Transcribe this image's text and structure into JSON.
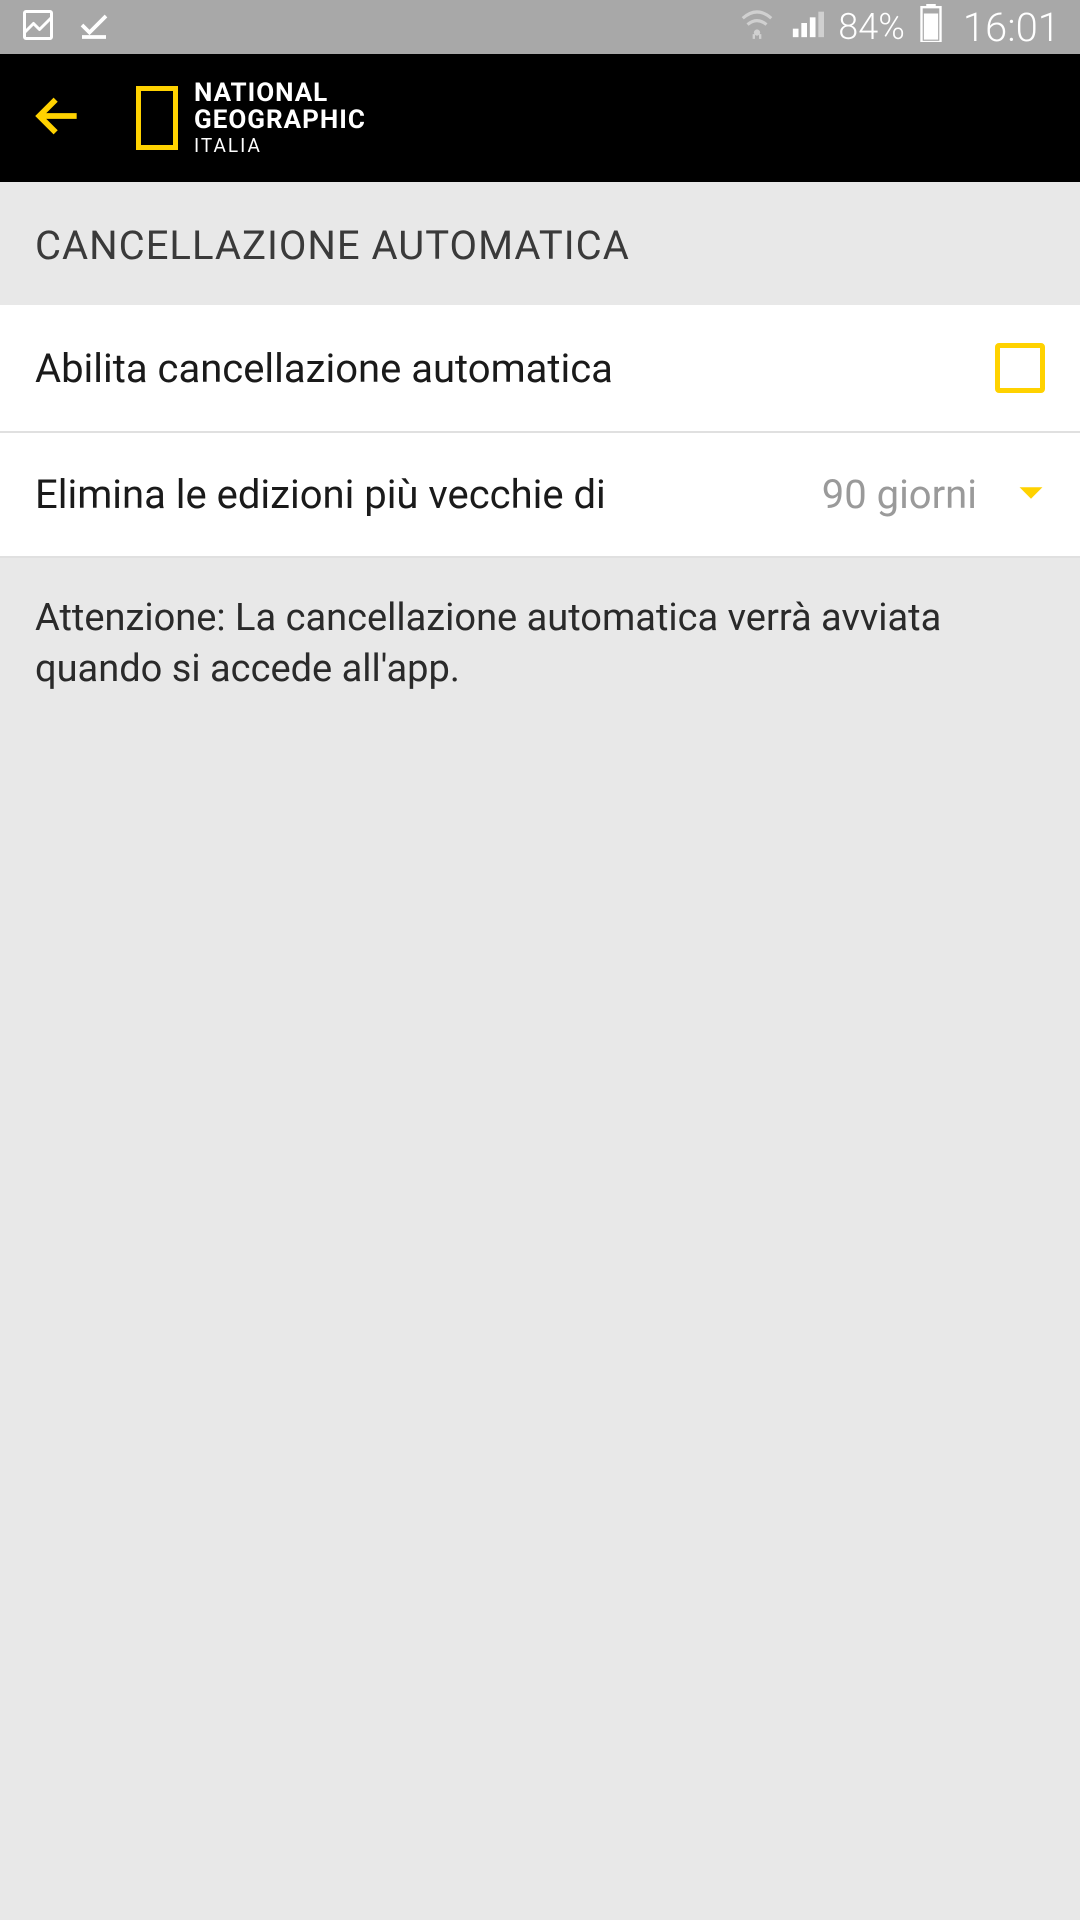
{
  "status_bar": {
    "battery_percent": "84%",
    "time": "16:01"
  },
  "app_bar": {
    "brand_line1": "NATIONAL",
    "brand_line2": "GEOGRAPHIC",
    "brand_sub": "ITALIA"
  },
  "section": {
    "title": "CANCELLAZIONE AUTOMATICA"
  },
  "settings": {
    "enable_label": "Abilita cancellazione automatica",
    "delete_older_label": "Elimina le edizioni più vecchie di",
    "delete_older_value": "90 giorni"
  },
  "warning": {
    "text": "Attenzione: La cancellazione automatica verrà avviata quando si accede all'app."
  }
}
